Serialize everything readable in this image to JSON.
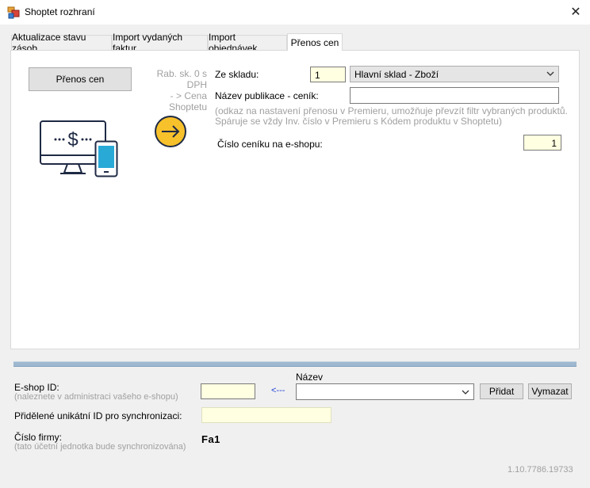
{
  "window": {
    "title": "Shoptet rozhraní",
    "close_glyph": "✕"
  },
  "tabs": [
    {
      "label": "Aktualizace stavu zásob"
    },
    {
      "label": "Import vydaných faktur"
    },
    {
      "label": "Import objednávek"
    },
    {
      "label": "Přenos cen"
    }
  ],
  "price_panel": {
    "button_label": "Přenos cen",
    "hint_line1": "Rab. sk. 0 s DPH",
    "hint_line2": "- > Cena Shoptetu",
    "warehouse_label": "Ze skladu:",
    "warehouse_number": "1",
    "warehouse_name": "Hlavní sklad - Zboží",
    "publication_label": "Název publikace - ceník:",
    "publication_value": "",
    "note_line1": "(odkaz na nastavení přenosu v Premieru, umožňuje převzít filtr vybraných produktů.",
    "note_line2": "Spáruje se vždy Inv. číslo  v Premieru s Kódem produktu v Shoptetu)",
    "pricelist_label": "Číslo ceníku na e-shopu:",
    "pricelist_value": "1"
  },
  "footer": {
    "eshop_id_label": "E-shop ID:",
    "eshop_id_hint": "(naleznete v administraci vašeho e-shopu)",
    "eshop_id_value": "",
    "arrow": "<---",
    "name_label": "Název",
    "name_value": "",
    "add_button": "Přidat",
    "delete_button": "Vymazat",
    "unique_id_label": "Přidělené unikátní ID pro synchronizaci:",
    "unique_id_value": "",
    "company_label": "Číslo firmy:",
    "company_hint": "(tato účetní jednotka bude synchronizována)",
    "company_value": "Fa1",
    "version": "1.10.7786.19733"
  },
  "icons": {
    "app": "app-icon",
    "monitor": "monitor-dollar-icon",
    "phone": "phone-icon",
    "arrow": "arrow-right-circle-icon",
    "chevron": "chevron-down-icon"
  },
  "colors": {
    "accent_yellow": "#f7c12b",
    "icon_blue": "#29a9d6",
    "field_yellow": "#ffffe1"
  }
}
